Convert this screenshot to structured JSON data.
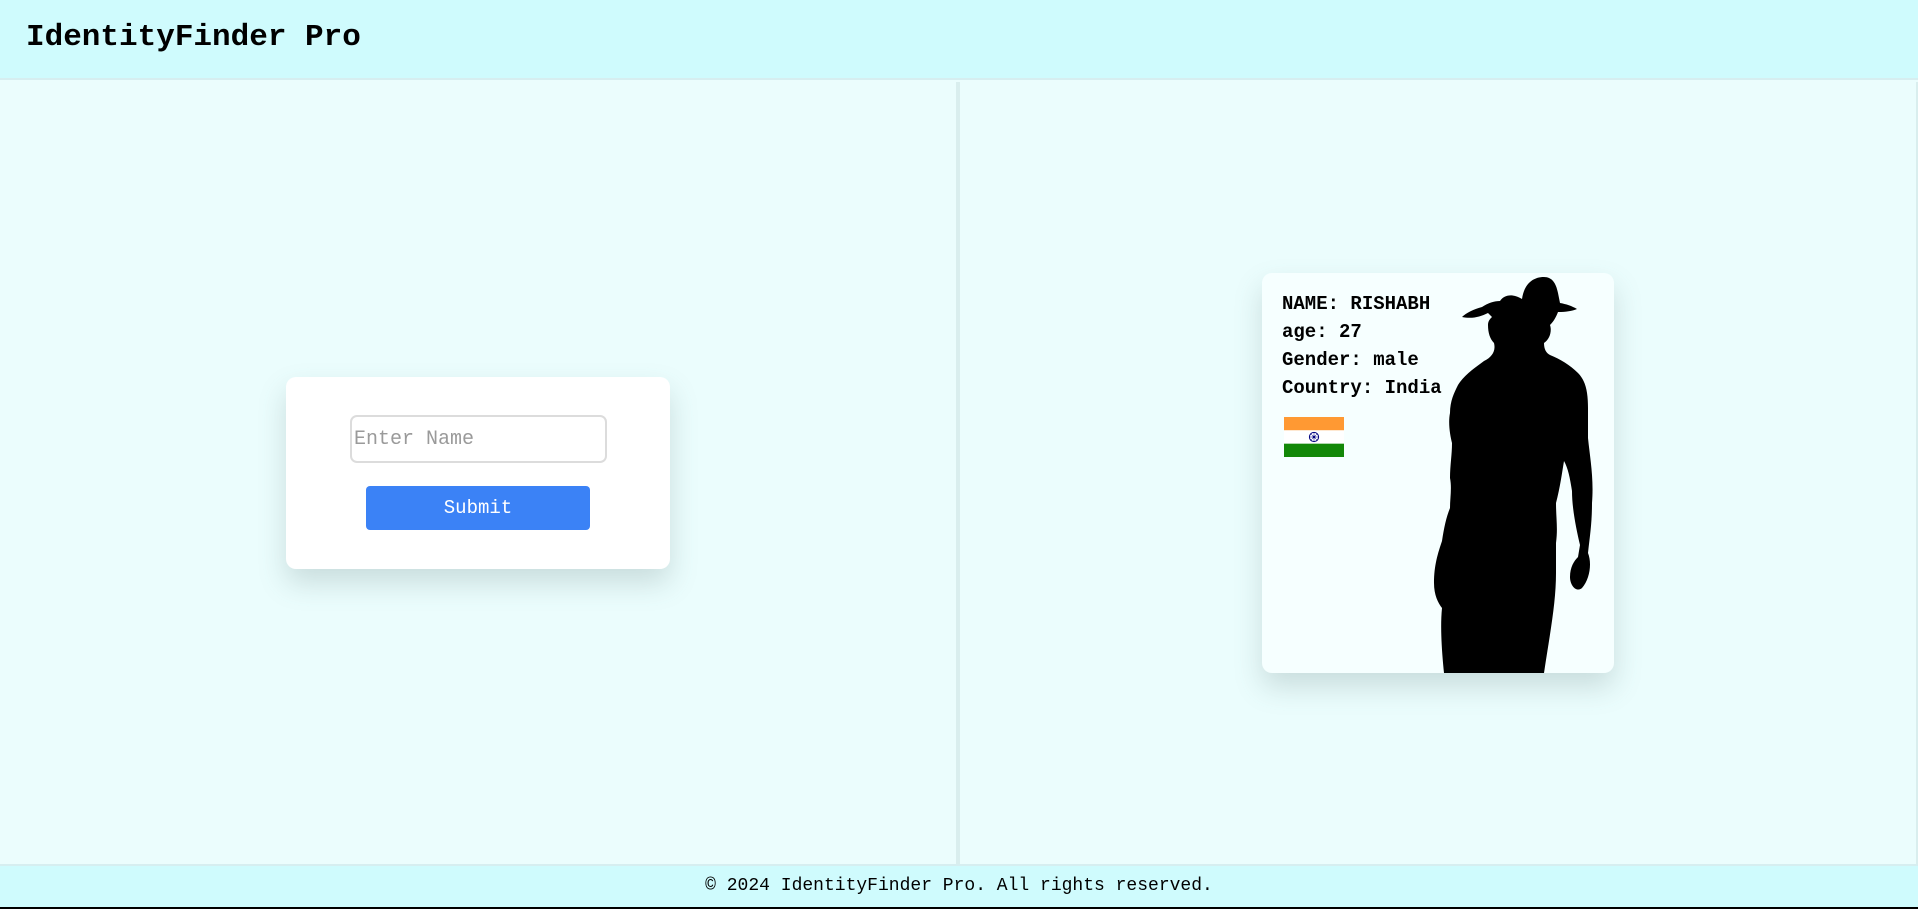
{
  "app": {
    "title": "IdentityFinder Pro"
  },
  "form": {
    "name_placeholder": "Enter Name",
    "name_value": "",
    "submit_label": "Submit"
  },
  "result": {
    "name_line": "NAME: RISHABH",
    "age_line": "age: 27",
    "gender_line": "Gender: male",
    "country_line": "Country: India",
    "flag_icon": "india-flag-icon",
    "image_icon": "male-silhouette-icon"
  },
  "footer": {
    "text": "© 2024 IdentityFinder Pro. All rights reserved."
  },
  "colors": {
    "header_bg": "#cffbfd",
    "page_bg": "#ebfdfd",
    "button_bg": "#3b82f6",
    "flag_saffron": "#ff9933",
    "flag_green": "#138808",
    "flag_chakra": "#000080"
  }
}
